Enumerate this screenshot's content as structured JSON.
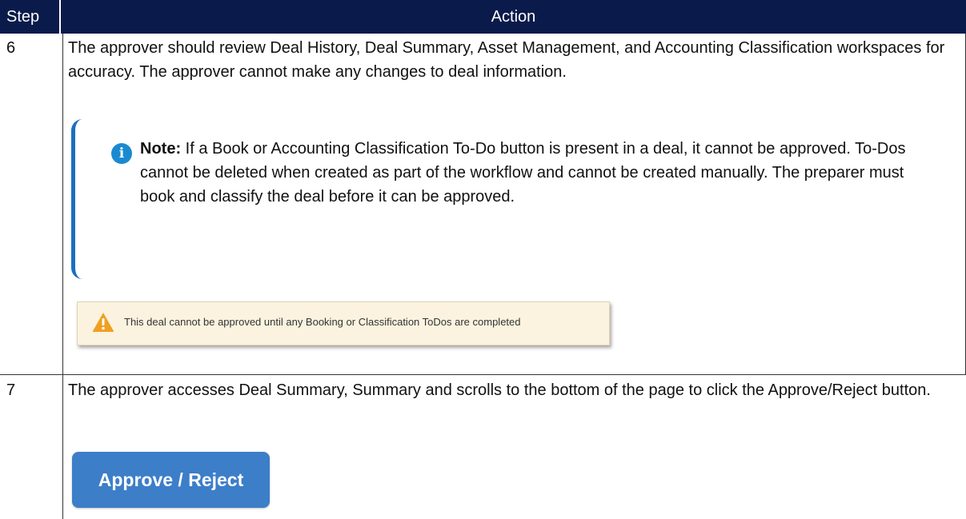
{
  "header": {
    "step_label": "Step",
    "action_label": "Action"
  },
  "rows": [
    {
      "step": "6",
      "text": "The approver should review Deal History, Deal Summary, Asset Management, and Accounting Classification workspaces for accuracy. The approver cannot make any changes to deal information.",
      "note": {
        "icon": "info-icon",
        "label": "Note:",
        "text": " If a Book or Accounting Classification To-Do button is present in a deal, it cannot be approved. To-Dos cannot be deleted when created as part of the workflow and cannot be created manually. The preparer must book and classify the deal before it can be approved."
      },
      "warning": {
        "icon": "warning-icon",
        "text": "This deal cannot be approved until any Booking or Classification ToDos are completed"
      }
    },
    {
      "step": "7",
      "text": "The approver accesses Deal Summary, Summary and scrolls to the bottom of the page to click the Approve/Reject button.",
      "button_label": "Approve / Reject"
    }
  ],
  "colors": {
    "header_bg": "#0a1a4b",
    "note_accent": "#1c6fc0",
    "warning_bg": "#fbf3df",
    "warning_icon": "#f0a020",
    "button_bg": "#3d7ec9"
  }
}
